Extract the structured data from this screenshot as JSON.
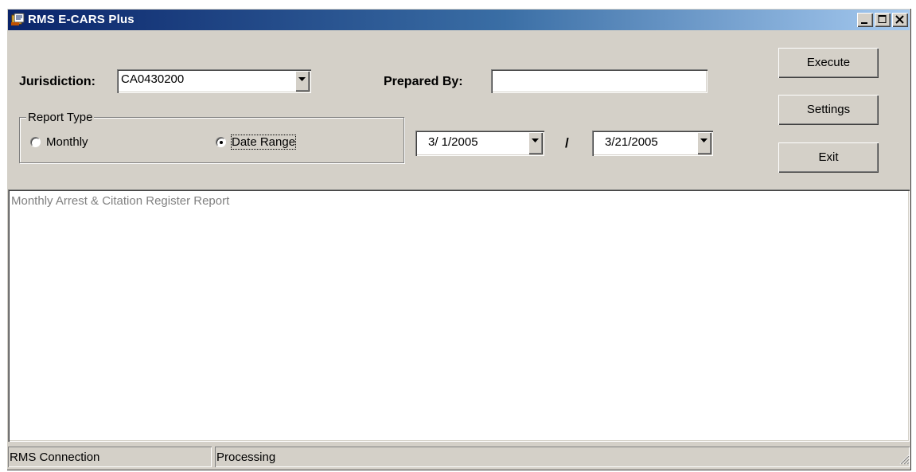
{
  "window": {
    "title": "RMS E-CARS Plus",
    "icon": "report-app-icon",
    "controls": [
      "minimize-icon",
      "maximize-icon",
      "close-icon"
    ]
  },
  "form": {
    "jurisdiction_label": "Jurisdiction:",
    "jurisdiction_value": "CA0430200",
    "prepared_by_label": "Prepared By:",
    "prepared_by_value": "",
    "report_type": {
      "legend": "Report Type",
      "options": [
        {
          "label": "Monthly",
          "selected": false
        },
        {
          "label": "Date Range",
          "selected": true
        }
      ]
    },
    "date_from": "3/ 1/2005",
    "date_separator": "/",
    "date_to": "3/21/2005"
  },
  "buttons": {
    "execute": "Execute",
    "settings": "Settings",
    "exit": "Exit"
  },
  "output": {
    "text": "Monthly Arrest & Citation Register Report"
  },
  "statusbar": {
    "connection": "RMS Connection",
    "state": "Processing"
  },
  "colors": {
    "face": "#d4d0c8",
    "title_start": "#0a246a",
    "title_end": "#a6caf0",
    "output_text": "#808080"
  }
}
